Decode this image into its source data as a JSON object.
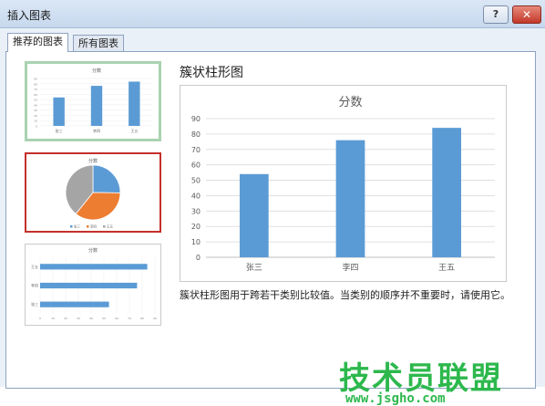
{
  "window": {
    "title": "插入图表",
    "help_label": "?",
    "close_label": "✕"
  },
  "tabs": [
    {
      "label": "推荐的图表"
    },
    {
      "label": "所有图表"
    }
  ],
  "thumbnails": {
    "bar": {
      "title": "分数",
      "categories": [
        "张三",
        "李四",
        "王五"
      ],
      "values": [
        54,
        76,
        84
      ]
    },
    "pie": {
      "title": "分数",
      "legend": [
        "张三",
        "李四",
        "王五"
      ],
      "values": [
        54,
        76,
        84
      ]
    },
    "hbar": {
      "title": "分数",
      "categories": [
        "王五",
        "李四",
        "张三"
      ],
      "values": [
        84,
        76,
        54
      ]
    }
  },
  "preview": {
    "heading": "簇状柱形图",
    "description": "簇状柱形图用于跨若干类别比较值。当类别的顺序并不重要时，请使用它。"
  },
  "chart_data": {
    "type": "bar",
    "title": "分数",
    "categories": [
      "张三",
      "李四",
      "王五"
    ],
    "values": [
      54,
      76,
      84
    ],
    "ylim": [
      0,
      90
    ],
    "yticks": [
      0,
      10,
      20,
      30,
      40,
      50,
      60,
      70,
      80,
      90
    ],
    "grid": true,
    "color": "#5b9bd5"
  },
  "watermark": {
    "text": "技术员联盟",
    "url": "www.jsgho.com",
    "color": "#2db84d"
  }
}
